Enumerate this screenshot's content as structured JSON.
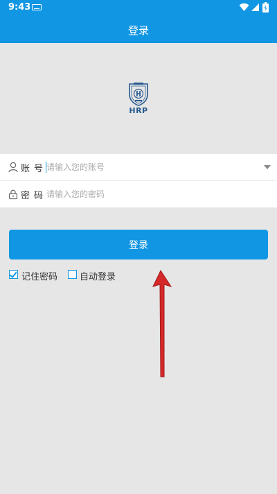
{
  "status_bar": {
    "time": "9:43"
  },
  "title_bar": {
    "title": "登录"
  },
  "logo": {
    "text": "HRP"
  },
  "form": {
    "account": {
      "label": "账号",
      "placeholder": "请输入您的账号"
    },
    "password": {
      "label": "密码",
      "placeholder": "请输入您的密码"
    }
  },
  "login_button": {
    "label": "登录"
  },
  "options": {
    "remember_password": {
      "label": "记住密码",
      "checked": true
    },
    "auto_login": {
      "label": "自动登录",
      "checked": false
    }
  },
  "colors": {
    "primary": "#1196e4",
    "background": "#e6e6e6",
    "annotation": "#d62a2a"
  }
}
